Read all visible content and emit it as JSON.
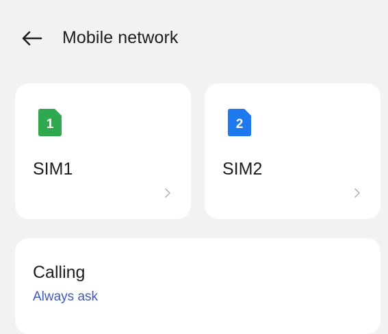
{
  "header": {
    "title": "Mobile network",
    "back_icon": "arrow-left-icon"
  },
  "sims": [
    {
      "label": "SIM1",
      "badge_number": "1",
      "color": "#2fa84f",
      "icon": "sim-card-icon"
    },
    {
      "label": "SIM2",
      "badge_number": "2",
      "color": "#1e78ee",
      "icon": "sim-card-icon"
    }
  ],
  "calling": {
    "title": "Calling",
    "value": "Always ask",
    "value_color": "#3f58b8"
  },
  "colors": {
    "background": "#f2f2f2",
    "card": "#ffffff",
    "chevron": "#b5b5b5"
  }
}
